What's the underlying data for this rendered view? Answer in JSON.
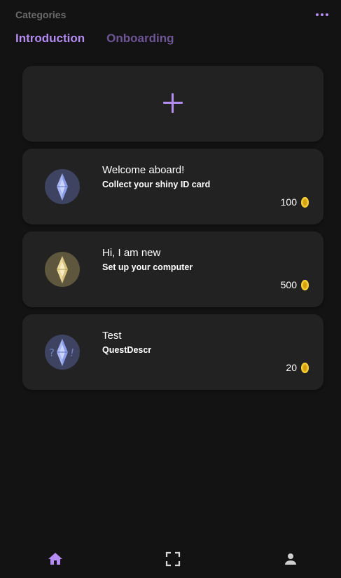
{
  "header": {
    "title": "Categories",
    "menu_icon": "more-dots-icon"
  },
  "tabs": [
    {
      "label": "Introduction",
      "active": true
    },
    {
      "label": "Onboarding",
      "active": false
    }
  ],
  "add_card": {
    "icon": "plus-icon"
  },
  "quests": [
    {
      "title": "Welcome aboard!",
      "description": "Collect your shiny ID card",
      "reward": "100",
      "badge_icon": "blue-crystal-icon"
    },
    {
      "title": "Hi, I am new",
      "description": "Set up your computer",
      "reward": "500",
      "badge_icon": "gold-crystal-icon"
    },
    {
      "title": "Test",
      "description": "QuestDescr",
      "reward": "20",
      "badge_icon": "blue-crystal-question-icon"
    }
  ],
  "bottom_nav": [
    {
      "icon": "home-icon",
      "active": true
    },
    {
      "icon": "scan-icon",
      "active": false
    },
    {
      "icon": "profile-icon",
      "active": false
    }
  ],
  "colors": {
    "background": "#131313",
    "card": "#222222",
    "accent": "#b48cf2",
    "accent_muted": "#6e5596",
    "coin": "#e9b61e"
  }
}
